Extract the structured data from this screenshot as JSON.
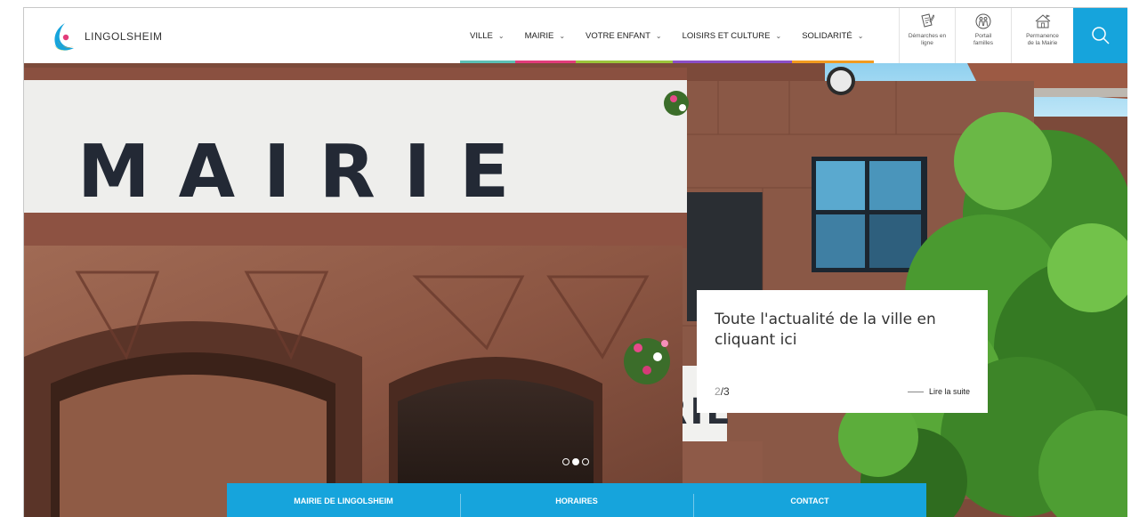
{
  "brand": {
    "name": "LINGOLSHEIM"
  },
  "nav": [
    {
      "label": "VILLE",
      "color": "#5bc0b5"
    },
    {
      "label": "MAIRIE",
      "color": "#e23c7a"
    },
    {
      "label": "VOTRE ENFANT",
      "color": "#9bc43a"
    },
    {
      "label": "LOISIRS ET CULTURE",
      "color": "#8a4ec6"
    },
    {
      "label": "SOLIDARITÉ",
      "color": "#f29b1f"
    }
  ],
  "quick_links": [
    {
      "icon": "edit-document-icon",
      "label_line1": "Démarches en",
      "label_line2": "ligne"
    },
    {
      "icon": "family-icon",
      "label_line1": "Portail",
      "label_line2": "familles"
    },
    {
      "icon": "town-hall-icon",
      "label_line1": "Permanence",
      "label_line2": "de la Mairie"
    }
  ],
  "search": {
    "icon": "search-icon",
    "color": "#16a4dc"
  },
  "hero": {
    "facade_text_top": "MAIRIE",
    "facade_text_bottom": "MAIRIE",
    "caption": {
      "title": "Toute l'actualité de la ville en cliquant ici",
      "current": "2",
      "total": "/3",
      "read_more": "Lire la suite"
    },
    "slides_count": 3,
    "active_slide": 2
  },
  "infobar": {
    "color": "#16a4dc",
    "items": [
      "MAIRIE DE LINGOLSHEIM",
      "HORAIRES",
      "CONTACT"
    ]
  }
}
